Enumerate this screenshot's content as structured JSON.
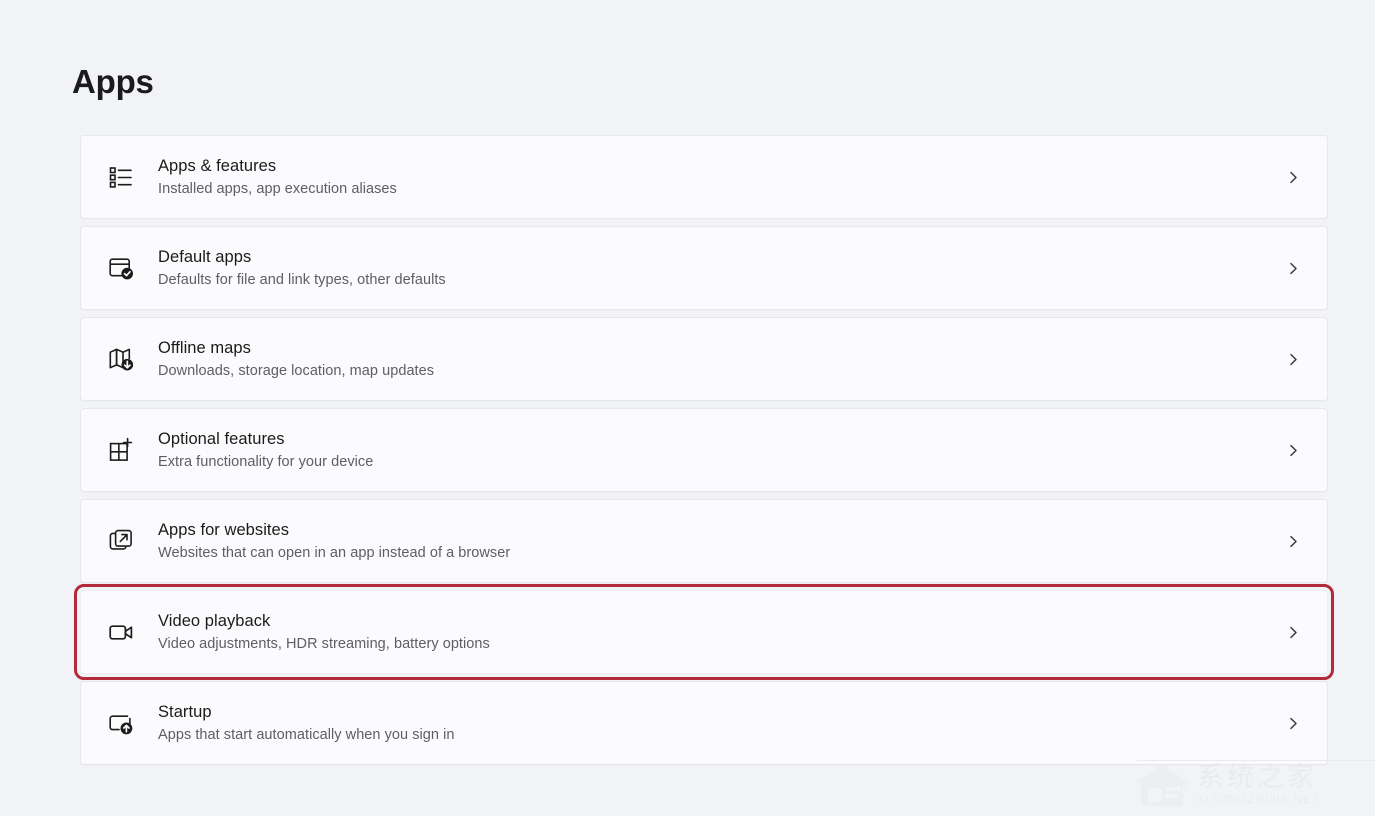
{
  "header": {
    "title": "Apps"
  },
  "settings": {
    "items": [
      {
        "icon": "bulleted-list-icon",
        "title": "Apps & features",
        "subtitle": "Installed apps, app execution aliases",
        "chevron": "chevron-right-icon",
        "highlighted": false
      },
      {
        "icon": "window-check-icon",
        "title": "Default apps",
        "subtitle": "Defaults for file and link types, other defaults",
        "chevron": "chevron-right-icon",
        "highlighted": false
      },
      {
        "icon": "map-download-icon",
        "title": "Offline maps",
        "subtitle": "Downloads, storage location, map updates",
        "chevron": "chevron-right-icon",
        "highlighted": false
      },
      {
        "icon": "grid-plus-icon",
        "title": "Optional features",
        "subtitle": "Extra functionality for your device",
        "chevron": "chevron-right-icon",
        "highlighted": false
      },
      {
        "icon": "open-in-new-icon",
        "title": "Apps for websites",
        "subtitle": "Websites that can open in an app instead of a browser",
        "chevron": "chevron-right-icon",
        "highlighted": false
      },
      {
        "icon": "video-camera-icon",
        "title": "Video playback",
        "subtitle": "Video adjustments, HDR streaming, battery options",
        "chevron": "chevron-right-icon",
        "highlighted": true
      },
      {
        "icon": "startup-arrow-icon",
        "title": "Startup",
        "subtitle": "Apps that start automatically when you sign in",
        "chevron": "chevron-right-icon",
        "highlighted": false
      }
    ]
  },
  "watermark": {
    "chinese": "系统之家",
    "english": "XITONGZHIJIA.NET",
    "logo": "house-logo-icon"
  },
  "colors": {
    "page_background": "#f2f3f7",
    "card_background": "#fbfbfd",
    "card_border": "#e8e8ec",
    "title_text": "#1b1b1b",
    "subtitle_text": "#5e5e63",
    "highlight_red": "#b22a3c"
  }
}
